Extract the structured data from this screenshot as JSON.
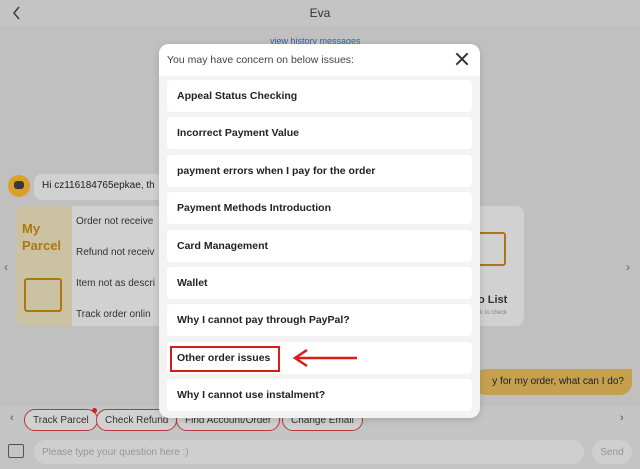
{
  "header": {
    "title": "Eva"
  },
  "chat": {
    "history_link": "view history messages",
    "greeting": "Hi cz116184765epkae, th",
    "parcel_card": {
      "title": "My Parcel",
      "items": [
        "Order not receive",
        "Refund not receiv",
        "Item not as descri",
        "Track order onlin"
      ]
    },
    "todo_card": {
      "label": "o List",
      "sub": "k to check"
    },
    "user_message": "y for my order, what can I do?"
  },
  "chips": [
    "Track Parcel",
    "Check Refund",
    "Find Account/Order",
    "Change Email"
  ],
  "input": {
    "placeholder": "Please type your question here :)",
    "send_label": "Send"
  },
  "modal": {
    "title": "You may have concern on below issues:",
    "items": [
      "Appeal Status Checking",
      "Incorrect Payment Value",
      "payment errors when I pay for the order",
      "Payment Methods Introduction",
      "Card Management",
      "Wallet",
      "Why I cannot pay through PayPal?",
      "Other order issues",
      "Why I cannot use instalment?"
    ]
  },
  "colors": {
    "highlight": "#d81b1b",
    "accent": "#b07a10",
    "chip_border": "#b83a3a"
  }
}
